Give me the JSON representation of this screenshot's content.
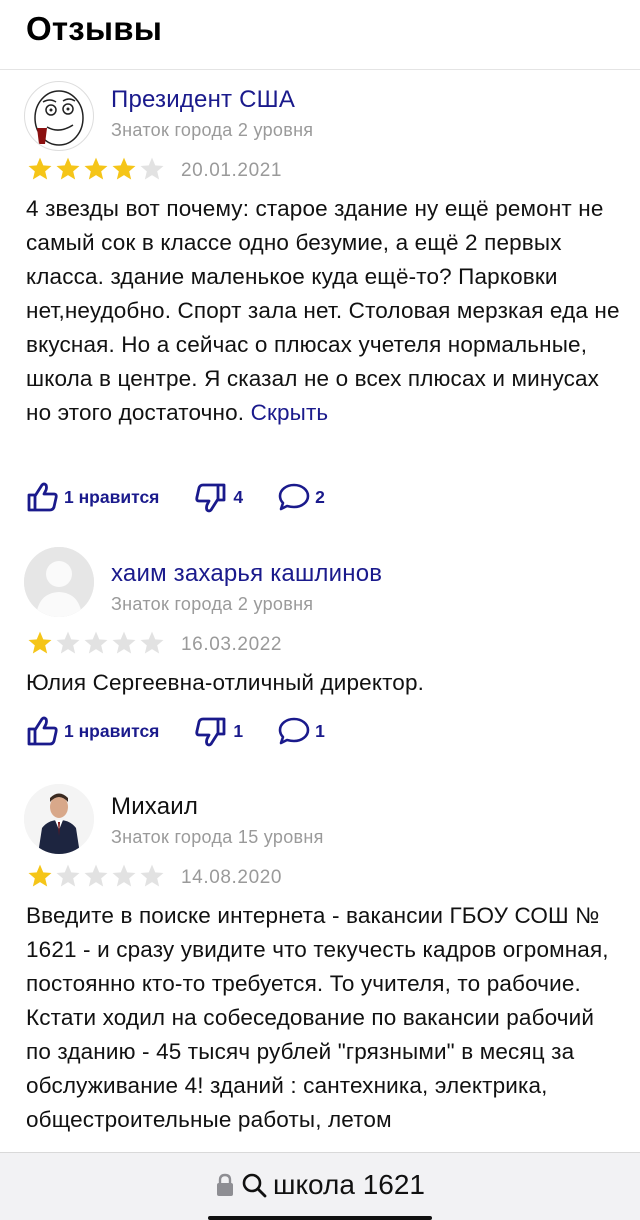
{
  "header": {
    "title": "Отзывы"
  },
  "reviews": [
    {
      "author": "Президент США",
      "level": "Знаток города 2 уровня",
      "rating": 4,
      "date": "20.01.2021",
      "text": "4 звезды вот почему: старое здание ну ещё ремонт не самый сок в классе одно безумие, а ещё 2 первых класса. здание маленькое куда ещё-то? Парковки нет,неудобно. Спорт зала нет. Столовая мерзкая еда не вкусная. Но а сейчас о плюсах учетеля нормальные, школа в центре. Я сказал не о всех плюсах и минусах но этого достаточно.",
      "hide_label": "Скрыть",
      "likes": "1 нравится",
      "dislikes": "4",
      "comments": "2"
    },
    {
      "author": "хаим захарья кашлинов",
      "level": "Знаток города 2 уровня",
      "rating": 1,
      "date": "16.03.2022",
      "text": "Юлия Сергеевна-отличный директор.",
      "likes": "1 нравится",
      "dislikes": "1",
      "comments": "1"
    },
    {
      "author": "Михаил",
      "level": "Знаток города 15 уровня",
      "rating": 1,
      "date": "14.08.2020",
      "text": "Введите в поиске интернета - вакансии ГБОУ СОШ № 1621 - и сразу увидите что текучесть кадров огромная, постоянно кто-то требуется. То учителя, то рабочие. Кстати ходил на собеседование по вакансии рабочий по зданию - 45 тысяч рублей \"грязными\" в месяц за обслуживание 4! зданий : сантехника, электрика, общестроительные работы, летом"
    }
  ],
  "browser": {
    "url_text": "школа 1621"
  },
  "colors": {
    "link": "#1a1a8c",
    "star_filled": "#f5c518",
    "star_empty": "#e2e2e2",
    "muted": "#9a9a9a"
  }
}
